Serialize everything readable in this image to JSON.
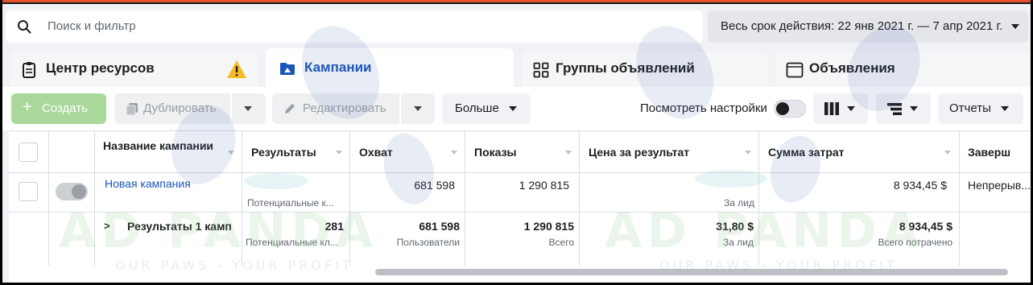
{
  "search": {
    "placeholder": "Поиск и фильтр"
  },
  "date_range": {
    "label": "Весь срок действия: 22 янв 2021 г. — 7 апр 2021 г."
  },
  "tabs": [
    {
      "label": "Центр ресурсов",
      "icon": "clipboard-icon",
      "warning_icon": "warning-icon"
    },
    {
      "label": "Кампании",
      "icon": "campaign-icon"
    },
    {
      "label": "Группы объявлений",
      "icon": "grid-icon"
    },
    {
      "label": "Объявления",
      "icon": "ad-window-icon"
    }
  ],
  "toolbar": {
    "create_label": "Создать",
    "duplicate_label": "Дублировать",
    "edit_label": "Редактировать",
    "more_label": "Больше",
    "view_settings_label": "Посмотреть настройки",
    "reports_label": "Отчеты"
  },
  "table": {
    "columns": [
      "Название кампании",
      "Результаты",
      "Охват",
      "Показы",
      "Цена за результат",
      "Сумма затрат",
      "Заверш"
    ],
    "rows": [
      {
        "name": "Новая кампания",
        "results": "",
        "results_sub": "Потенциальные к...",
        "reach": "681 598",
        "impressions": "1 290 815",
        "cost_per_result": "",
        "cost_per_result_sub": "За лид",
        "amount_spent": "8 934,45 $",
        "ends": "Непрерыв..."
      }
    ],
    "summary": {
      "name": "Результаты 1 камп",
      "results": "281",
      "results_sub": "Потенциальные кл...",
      "reach": "681 598",
      "reach_sub": "Пользователи",
      "impressions": "1 290 815",
      "impressions_sub": "Всего",
      "cost_per_result": "31,80 $",
      "cost_per_result_sub": "За лид",
      "amount_spent": "8 934,45 $",
      "amount_spent_sub": "Всего потрачено"
    }
  },
  "watermark": {
    "brand": "AD PANDA",
    "tagline": "OUR PAWS - YOUR PROFIT"
  },
  "colors": {
    "accent": "#1a56b8",
    "create_button": "#a8d99a",
    "warning": "#f7b928",
    "top_bar": "#e4522b"
  }
}
